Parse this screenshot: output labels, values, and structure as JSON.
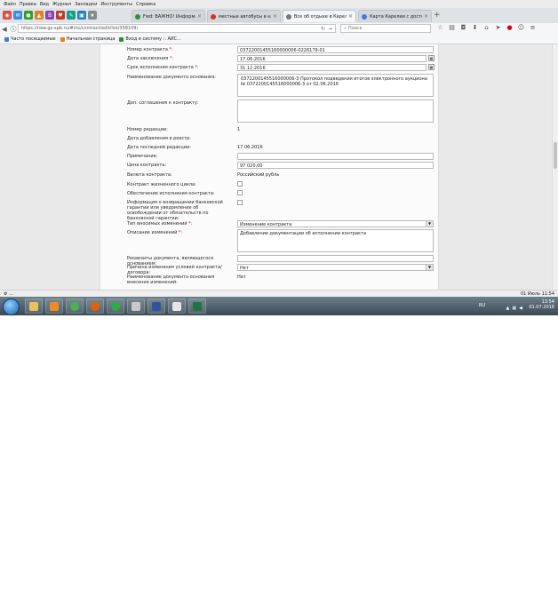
{
  "menu": [
    "Файл",
    "Правка",
    "Вид",
    "Журнал",
    "Закладки",
    "Инструменты",
    "Справка"
  ],
  "tabs": [
    {
      "title": "Fwd: ВАЖНО! Информац...",
      "active": false,
      "color": "#2a8f3c"
    },
    {
      "title": "местные автобусы в каке...",
      "active": false,
      "color": "#d93025"
    },
    {
      "title": "Все об отдыхе в Карелии ...",
      "active": true,
      "color": "#777777"
    },
    {
      "title": "Карта Карелии с достопр...",
      "active": false,
      "color": "#3b7dd8"
    }
  ],
  "nav": {
    "url": "https://new.gz-spb.ru/#cts/contract/edit/list/358109/",
    "search_placeholder": "Поиск"
  },
  "bookmarks": [
    "Часто посещаемые",
    "Начальная страница",
    "Вход в систему :: АИС..."
  ],
  "form": {
    "contract_number_label": "Номер контракта",
    "contract_number": "03722001455160000006-0226179-01",
    "conclusion_date_label": "Дата заключения",
    "conclusion_date": "17.06.2016",
    "execution_term_label": "Срок исполнения контракта",
    "execution_term": "31.12.2016",
    "basis_doc_label": "Наименование документа основания:",
    "basis_doc": "0372200145516000006-3 Протокол подведения итогов электронного аукциона № 0372200145516000006-3 от 02.06.2016",
    "extra_agreements_label": "Доп. соглашения к контракту:",
    "extra_agreements": "",
    "revision_number_label": "Номер редакции:",
    "revision_number": "1",
    "registry_date_label": "Дата добавления в реестр:",
    "registry_date": "",
    "last_revision_date_label": "Дата последней редакции:",
    "last_revision_date": "17.06.2016",
    "note_label": "Примечание:",
    "note": "",
    "price_label": "Цена контракта:",
    "price": "97 020,00",
    "currency_label": "Валюта контракта:",
    "currency": "Российский рубль",
    "life_cycle_label": "Контракт жизненного цикла:",
    "security_label": "Обеспечение исполнения контракта:",
    "guarantee_info_label": "Информация о возвращении банковской гарантии или уведомление об освобождении от обязательств по банковской гарантии:",
    "change_type_label": "Тип вносимых изменений",
    "change_type": "Изменение контракта",
    "change_desc_label": "Описание изменений",
    "change_desc": "Добавление документации об исполнении контракта",
    "doc_requisites_label": "Реквизиты документа, являющегося основанием:",
    "doc_requisites": "",
    "change_reason_label": "Причина изменения условий контракта/договора:",
    "change_reason": "Нет",
    "basis_doc_name_label": "Наименование документа основания внесения изменений:",
    "basis_doc_name": "Нет"
  },
  "status": {
    "left": "⚙ ...",
    "right": "01 Июль 11:54"
  },
  "taskbar": {
    "lang": "RU",
    "time": "13:54",
    "date": "01.07.2016"
  }
}
